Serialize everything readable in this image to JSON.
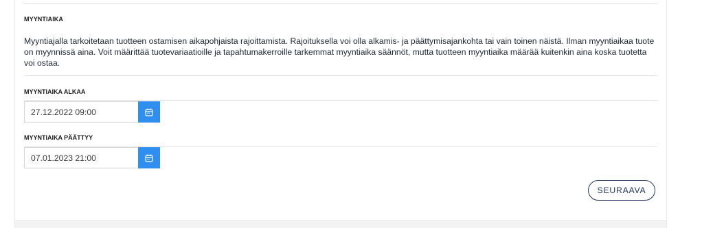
{
  "section": {
    "title": "MYYNTIAIKA",
    "description": "Myyntiajalla tarkoitetaan tuotteen ostamisen aikapohjaista rajoittamista. Rajoituksella voi olla alkamis- ja päättymisajankohta tai vain toinen näistä. Ilman myyntiaikaa tuote on myynnissä aina. Voit määrittää tuotevariaatioille ja tapahtumakerroille tarkemmat myyntiaika säännöt, mutta tuotteen myyntiaika määrää kuitenkin aina koska tuotetta voi ostaa."
  },
  "fields": {
    "start": {
      "label": "MYYNTIAIKA ALKAA",
      "value": "27.12.2022 09:00",
      "icon": "calendar-icon"
    },
    "end": {
      "label": "MYYNTIAIKA PÄÄTTYY",
      "value": "07.01.2023 21:00",
      "icon": "calendar-icon"
    }
  },
  "actions": {
    "next_label": "SEURAAVA"
  },
  "colors": {
    "accent": "#2f8ff0",
    "button_outline": "#23355c",
    "text": "#1d2733"
  }
}
